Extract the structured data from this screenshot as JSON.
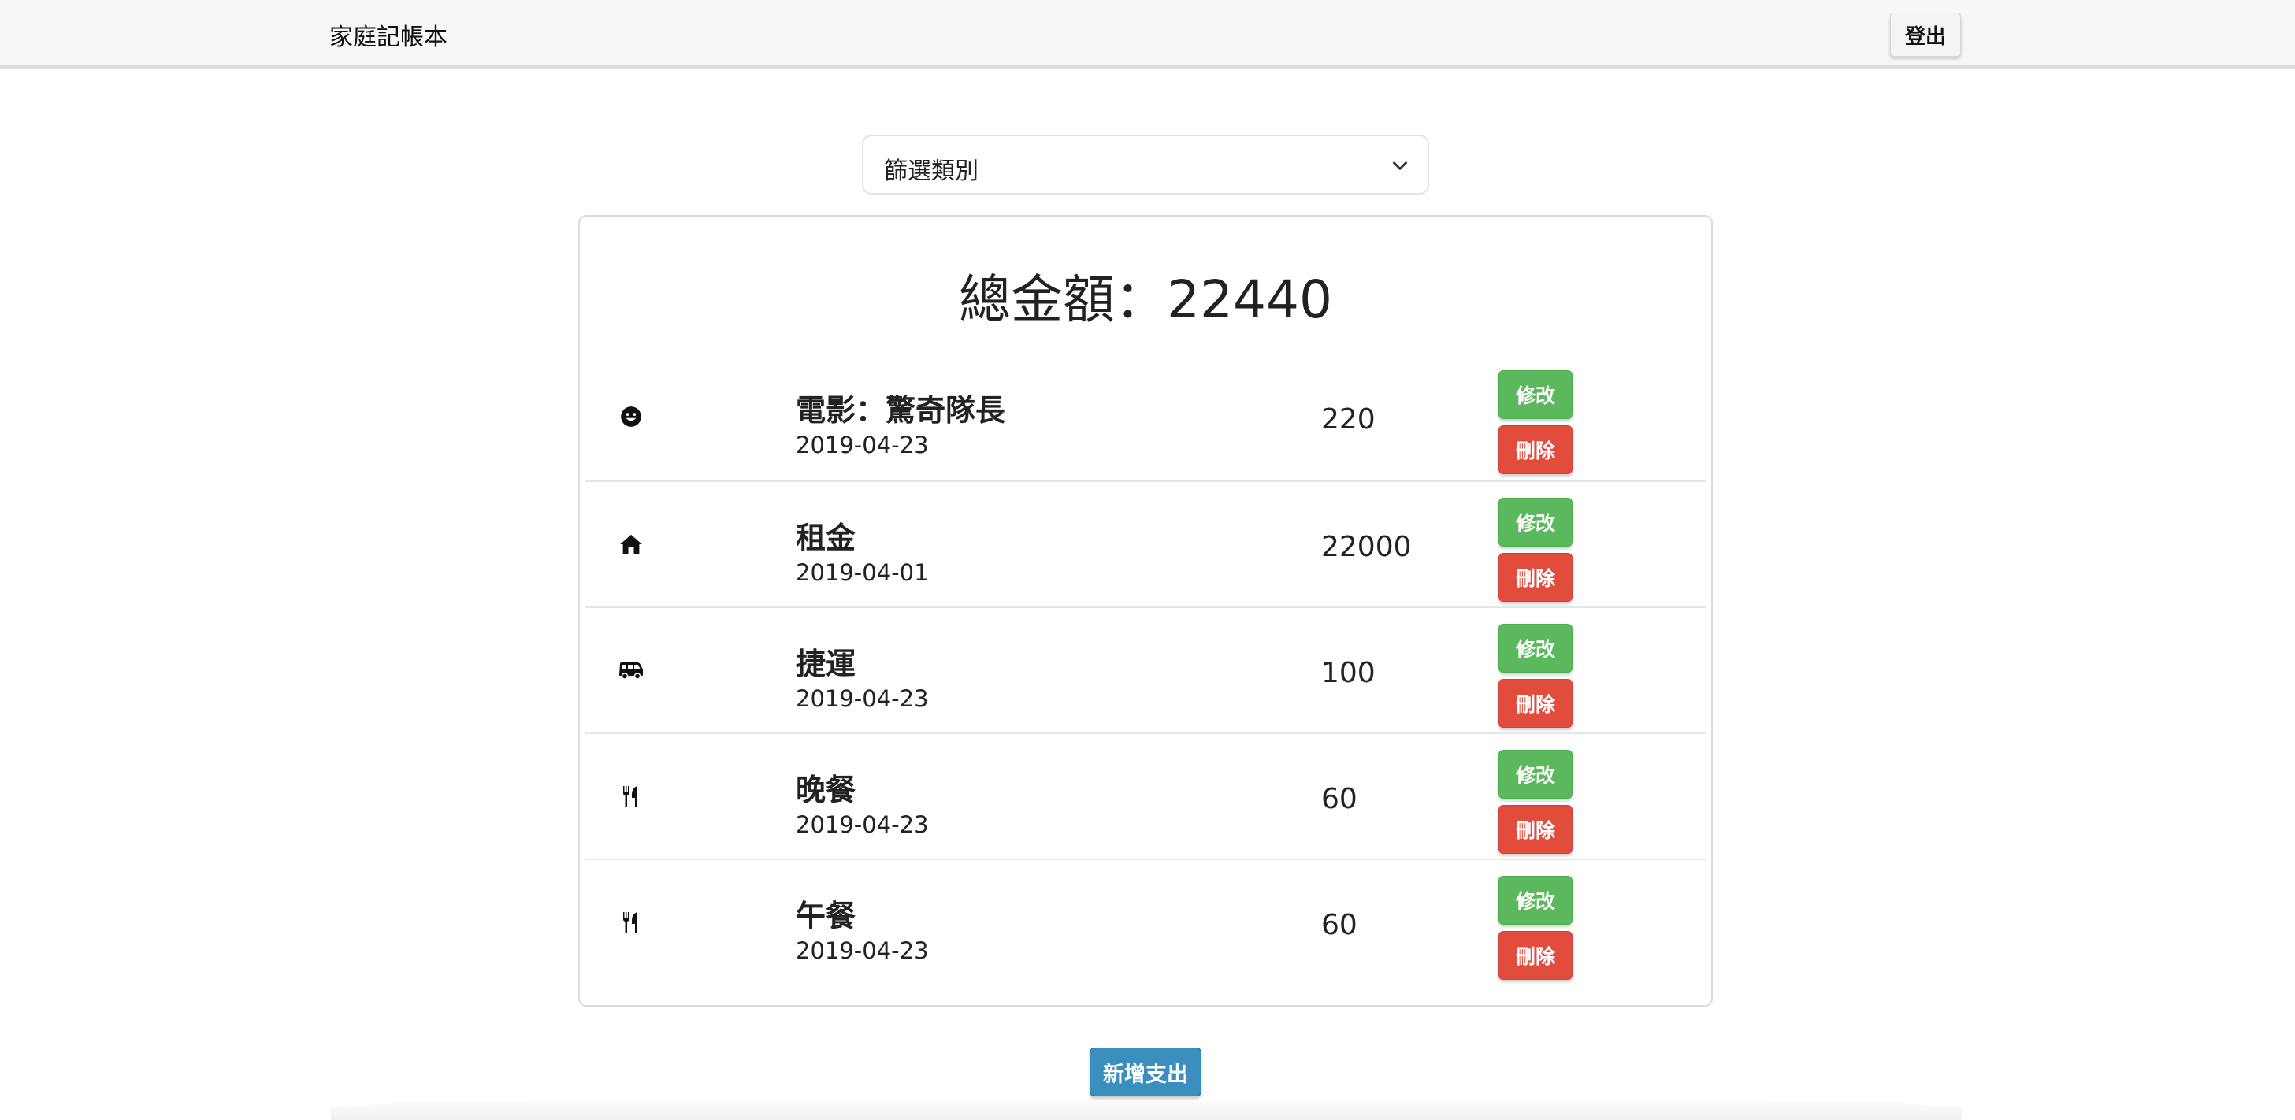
{
  "navbar": {
    "brand": "家庭記帳本",
    "logout_label": "登出"
  },
  "filter": {
    "label": "篩選類別",
    "icon": "chevron-down-icon"
  },
  "summary": {
    "total_label": "總金額：22440"
  },
  "expenses": [
    {
      "icon": "smile-icon",
      "title": "電影：驚奇隊長",
      "date": "2019-04-23",
      "amount": "220",
      "edit_label": "修改",
      "delete_label": "刪除"
    },
    {
      "icon": "home-icon",
      "title": "租金",
      "date": "2019-04-01",
      "amount": "22000",
      "edit_label": "修改",
      "delete_label": "刪除"
    },
    {
      "icon": "shuttle-van-icon",
      "title": "捷運",
      "date": "2019-04-23",
      "amount": "100",
      "edit_label": "修改",
      "delete_label": "刪除"
    },
    {
      "icon": "utensils-icon",
      "title": "晚餐",
      "date": "2019-04-23",
      "amount": "60",
      "edit_label": "修改",
      "delete_label": "刪除"
    },
    {
      "icon": "utensils-icon",
      "title": "午餐",
      "date": "2019-04-23",
      "amount": "60",
      "edit_label": "修改",
      "delete_label": "刪除"
    }
  ],
  "actions": {
    "add_label": "新增支出"
  },
  "colors": {
    "edit": "#5cb85c",
    "delete": "#e24c3c",
    "add": "#3b8fbf",
    "navbar": "#f7f7f7"
  }
}
